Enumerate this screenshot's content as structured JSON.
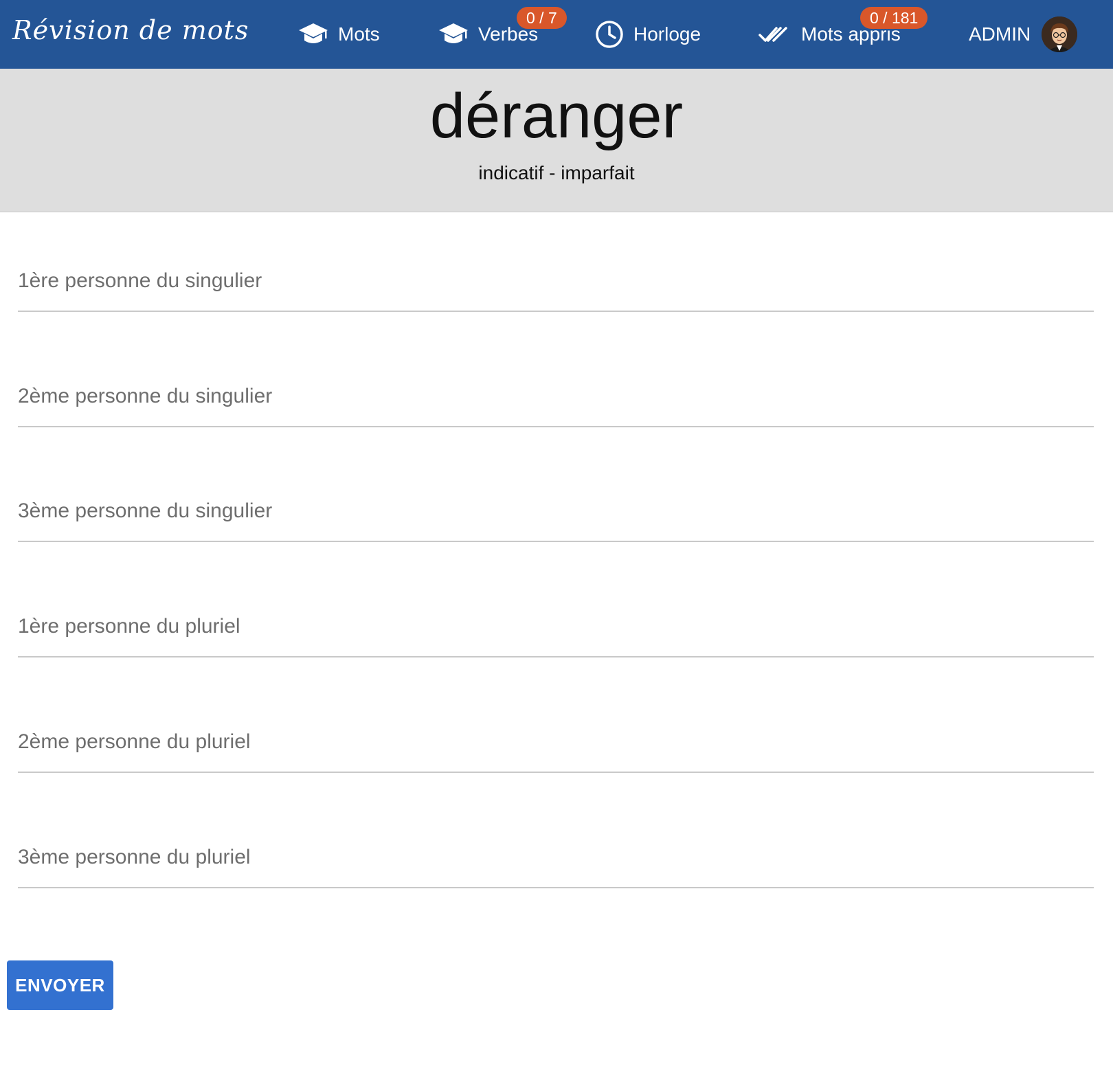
{
  "navbar": {
    "brand": "Révision de mots",
    "background": "#245596",
    "items": [
      {
        "label": "Mots",
        "icon": "graduation-cap-icon"
      },
      {
        "label": "Verbes",
        "icon": "graduation-cap-icon",
        "badge": "0 / 7"
      },
      {
        "label": "Horloge",
        "icon": "clock-icon"
      },
      {
        "label": "Mots appris",
        "icon": "double-check-icon",
        "badge": "0 / 181"
      }
    ],
    "user": {
      "label": "ADMIN",
      "avatar_icon": "user-avatar"
    },
    "badge_color": "#d9572a"
  },
  "verb": {
    "word": "déranger",
    "tense": "indicatif - imparfait"
  },
  "form": {
    "fields": [
      {
        "placeholder": "1ère personne du singulier",
        "value": ""
      },
      {
        "placeholder": "2ème personne du singulier",
        "value": ""
      },
      {
        "placeholder": "3ème personne du singulier",
        "value": ""
      },
      {
        "placeholder": "1ère personne du pluriel",
        "value": ""
      },
      {
        "placeholder": "2ème personne du pluriel",
        "value": ""
      },
      {
        "placeholder": "3ème personne du pluriel",
        "value": ""
      }
    ],
    "submit_label": "ENVOYER",
    "submit_color": "#3371d0"
  }
}
